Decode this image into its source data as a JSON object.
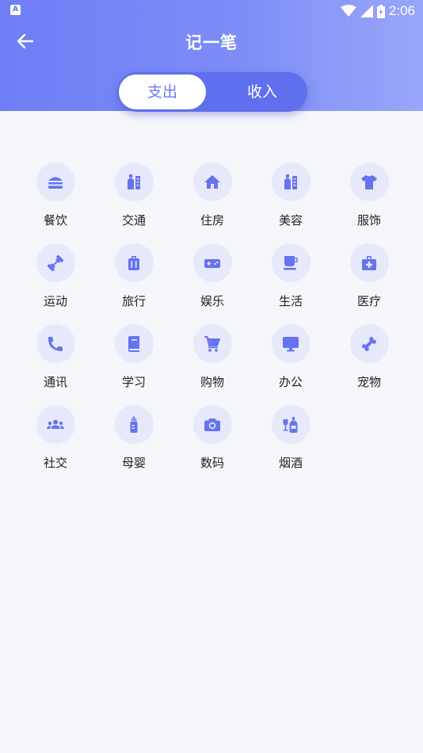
{
  "status_bar": {
    "time": "2:06",
    "app_icon_letter": "A"
  },
  "nav": {
    "title": "记一笔",
    "back_icon": "arrow-left-icon"
  },
  "tabs": [
    {
      "label": "支出",
      "active": true
    },
    {
      "label": "收入",
      "active": false
    }
  ],
  "colors": {
    "accent": "#6f7ef5",
    "icon_fg": "#6573ee",
    "icon_bg": "#e6e9fa",
    "page_bg": "#f5f6fa"
  },
  "categories": [
    {
      "label": "餐饮",
      "icon": "burger-icon"
    },
    {
      "label": "交通",
      "icon": "bottle-ruler-icon"
    },
    {
      "label": "住房",
      "icon": "house-icon"
    },
    {
      "label": "美容",
      "icon": "bottle-ruler-icon"
    },
    {
      "label": "服饰",
      "icon": "tshirt-icon"
    },
    {
      "label": "运动",
      "icon": "dumbbell-icon"
    },
    {
      "label": "旅行",
      "icon": "luggage-icon"
    },
    {
      "label": "娱乐",
      "icon": "gamepad-icon"
    },
    {
      "label": "生活",
      "icon": "coffee-cup-icon"
    },
    {
      "label": "医疗",
      "icon": "medical-kit-icon"
    },
    {
      "label": "通讯",
      "icon": "phone-icon"
    },
    {
      "label": "学习",
      "icon": "book-icon"
    },
    {
      "label": "购物",
      "icon": "cart-icon"
    },
    {
      "label": "办公",
      "icon": "monitor-icon"
    },
    {
      "label": "宠物",
      "icon": "bone-icon"
    },
    {
      "label": "社交",
      "icon": "group-icon"
    },
    {
      "label": "母婴",
      "icon": "baby-bottle-icon"
    },
    {
      "label": "数码",
      "icon": "camera-icon"
    },
    {
      "label": "烟酒",
      "icon": "wine-bottle-icon"
    }
  ]
}
